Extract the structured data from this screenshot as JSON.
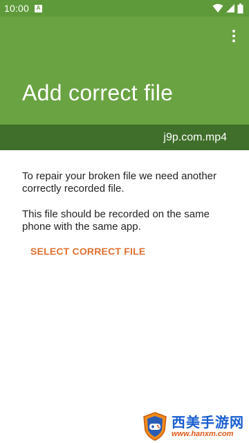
{
  "status_bar": {
    "time": "10:00",
    "notification_icon": "a-notification-icon",
    "wifi_icon": "wifi-icon",
    "signal_icon": "cell-signal-icon",
    "battery_icon": "battery-icon"
  },
  "app_bar": {
    "title": "Add correct file",
    "overflow_icon": "more-vert-icon",
    "color": "#6aa342"
  },
  "file_strip": {
    "filename": "j9p.com.mp4",
    "color": "#3f6f2a"
  },
  "content": {
    "paragraph_1": "To repair your broken file we need another correctly recorded file.",
    "paragraph_2": "This file should be recorded on the same phone with the same app.",
    "select_button_label": "SELECT CORRECT FILE",
    "accent_color": "#e07030"
  },
  "watermark": {
    "site_name_cn": "西美手游网",
    "site_url": "www.hanxm.com"
  }
}
